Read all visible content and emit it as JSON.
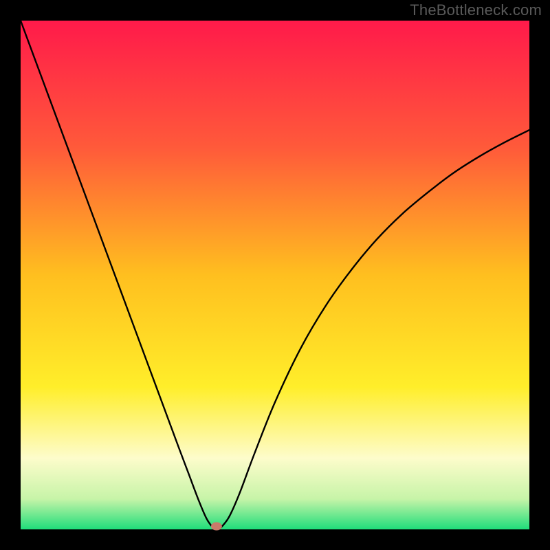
{
  "watermark": "TheBottleneck.com",
  "chart_data": {
    "type": "line",
    "title": "",
    "xlabel": "",
    "ylabel": "",
    "xlim": [
      0,
      100
    ],
    "ylim": [
      0,
      100
    ],
    "gradient_stops": [
      {
        "pos": 0.0,
        "color": "#ff1a4a"
      },
      {
        "pos": 0.25,
        "color": "#ff5a3a"
      },
      {
        "pos": 0.5,
        "color": "#ffbf1f"
      },
      {
        "pos": 0.72,
        "color": "#ffee2a"
      },
      {
        "pos": 0.86,
        "color": "#fdfccb"
      },
      {
        "pos": 0.94,
        "color": "#c7f4a8"
      },
      {
        "pos": 1.0,
        "color": "#1fdd7a"
      }
    ],
    "series": [
      {
        "name": "bottleneck-curve",
        "x": [
          0,
          5,
          10,
          15,
          20,
          25,
          28,
          31,
          33,
          35,
          36.5,
          37.5,
          38.2,
          38.8,
          39.5,
          41,
          43,
          46,
          50,
          55,
          60,
          65,
          70,
          75,
          80,
          85,
          90,
          95,
          100
        ],
        "y": [
          100,
          86.5,
          73,
          59.5,
          46,
          32.5,
          24.4,
          16.3,
          11,
          5.7,
          2.2,
          0.7,
          0.12,
          0.1,
          0.5,
          2.5,
          7,
          15,
          25,
          35.5,
          44,
          51,
          57,
          62,
          66.2,
          70,
          73.2,
          76,
          78.5
        ]
      }
    ],
    "marker": {
      "x": 38.5,
      "y": 0.6,
      "color": "#c97a6a"
    },
    "line_color": "#000000",
    "line_width": 2.4
  }
}
